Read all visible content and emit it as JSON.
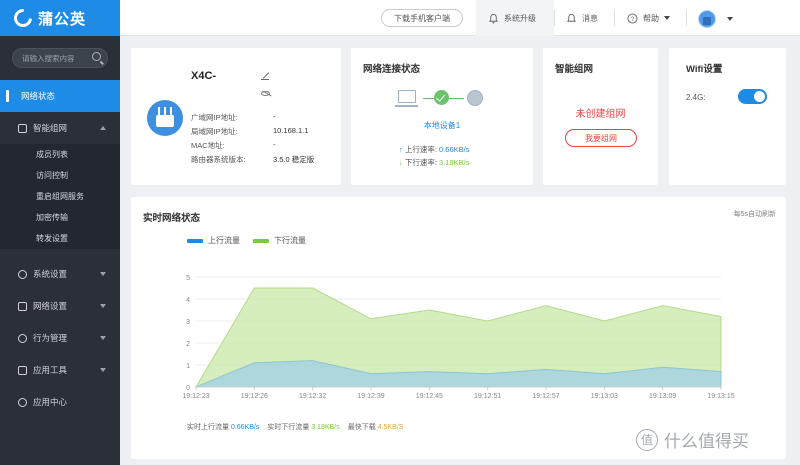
{
  "app": {
    "logo_text": "蒲公英"
  },
  "header": {
    "download_button": "下载手机客户端",
    "upgrade": "系统升级",
    "messages": "消息",
    "help": "帮助"
  },
  "sidebar": {
    "search_placeholder": "请输入搜索内容",
    "items": [
      {
        "label": "网络状态",
        "active": true
      },
      {
        "label": "智能组网"
      },
      {
        "label": "系统设置"
      },
      {
        "label": "网络设置"
      },
      {
        "label": "行为管理"
      },
      {
        "label": "应用工具"
      },
      {
        "label": "应用中心"
      }
    ],
    "sub_items": [
      "成员列表",
      "访问控制",
      "重启组网服务",
      "加密传输",
      "转发设置"
    ]
  },
  "device": {
    "name": "X4C-",
    "rows": [
      {
        "label": "广域网IP地址:",
        "value": "-"
      },
      {
        "label": "局域网IP地址:",
        "value": "10.168.1.1"
      },
      {
        "label": "MAC地址:",
        "value": "-"
      },
      {
        "label": "路由器系统版本:",
        "value": "3.5.0 稳定版"
      }
    ]
  },
  "network": {
    "title": "网络连接状态",
    "local_device": "本地设备1",
    "up_label": "上行速率:",
    "up_value": "0.66KB/s",
    "down_label": "下行速率:",
    "down_value": "3.19KB/s"
  },
  "mesh": {
    "title": "智能组网",
    "message": "未创建组网",
    "button": "我要组网"
  },
  "wifi": {
    "title": "Wifi设置",
    "band_label": "2.4G:",
    "enabled": true
  },
  "realtime": {
    "title": "实时网络状态",
    "refresh_note": "每5s自动刷新",
    "legend_up": "上行流量",
    "legend_down": "下行流量",
    "footer": {
      "up_label": "实时上行流量",
      "up_value": "0.66KB/s",
      "down_label": "实时下行流量",
      "down_value": "3.19KB/s",
      "max_label": "最快下载",
      "max_value": "4.5KB/S"
    }
  },
  "colors": {
    "accent": "#1e8be6",
    "down": "#7ac943",
    "warn": "#e64545"
  },
  "chart_data": {
    "type": "area",
    "x": [
      "19:12:23",
      "19:12:26",
      "19:12:32",
      "19:12:39",
      "19:12:45",
      "19:12:51",
      "19:12:57",
      "19:13:03",
      "19:13:09",
      "19:13:15"
    ],
    "ylim": [
      0,
      5
    ],
    "yticks": [
      0,
      1,
      2,
      3,
      4,
      5
    ],
    "grid": true,
    "series": [
      {
        "name": "下行流量",
        "color": "#c8e8a8",
        "values": [
          0,
          4.5,
          4.5,
          3.1,
          3.5,
          3.0,
          3.7,
          3.0,
          3.7,
          3.2
        ]
      },
      {
        "name": "上行流量",
        "color": "#a8d4e0",
        "values": [
          0,
          1.1,
          1.2,
          0.6,
          0.7,
          0.6,
          0.8,
          0.6,
          0.9,
          0.7
        ]
      }
    ]
  },
  "watermark": {
    "text": "什么值得买",
    "glyph": "值"
  }
}
